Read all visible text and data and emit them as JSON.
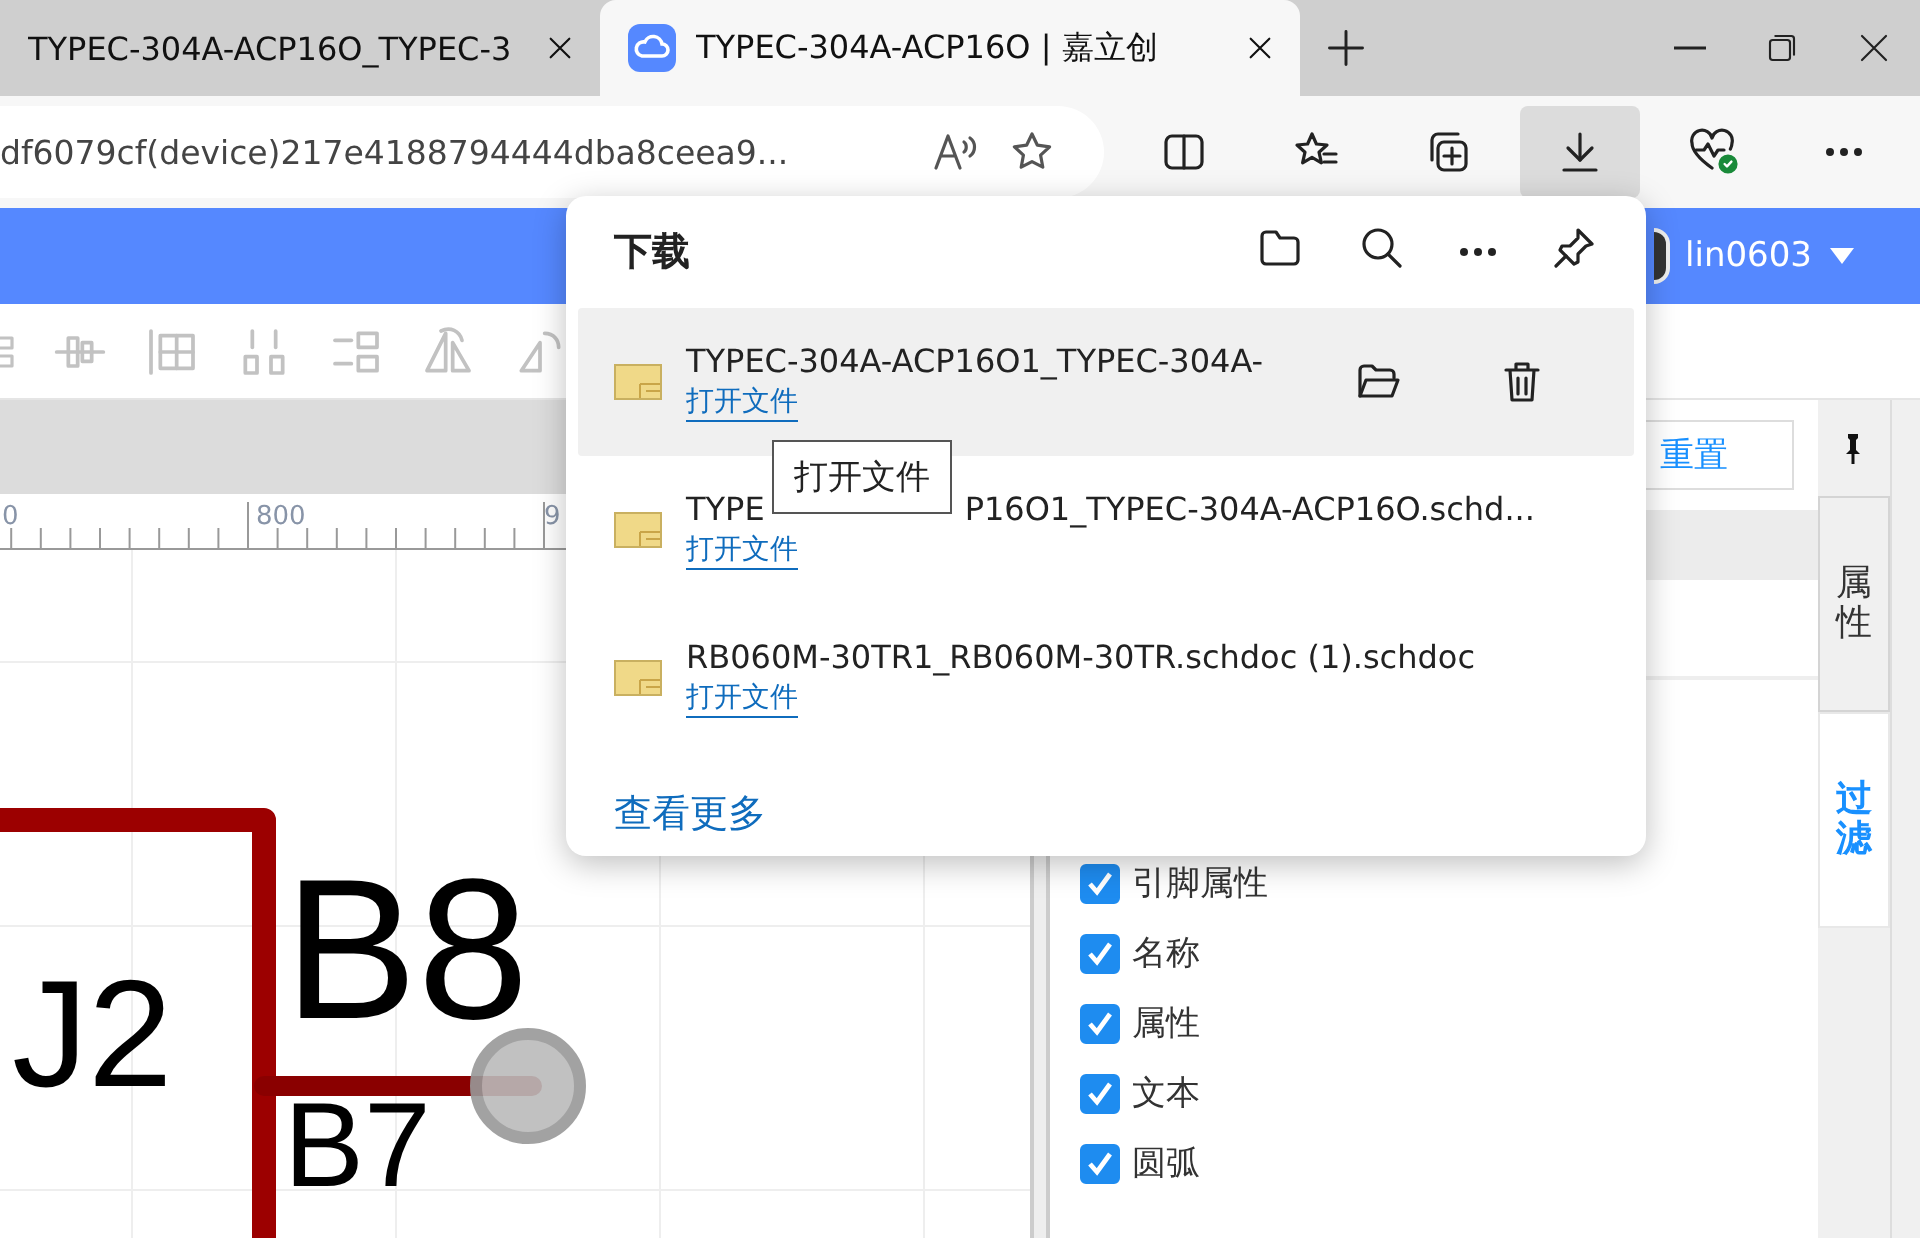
{
  "browser_tabs": [
    {
      "title": "TYPEC-304A-ACP16O_TYPEC-3",
      "selected": false
    },
    {
      "title": "TYPEC-304A-ACP16O | 嘉立创",
      "selected": true
    }
  ],
  "address_bar": {
    "url": "df6079cf(device)217e4188794444dba8ceea9..."
  },
  "browser_toolbar": [
    {
      "kind": "split",
      "selected": false
    },
    {
      "kind": "favorites",
      "selected": false
    },
    {
      "kind": "collections",
      "selected": false
    },
    {
      "kind": "downloads",
      "selected": true
    },
    {
      "kind": "health",
      "selected": false
    },
    {
      "kind": "more",
      "selected": false
    }
  ],
  "app_bar": {
    "user": "lin0603"
  },
  "ruler": {
    "labels": [
      "0",
      "800",
      "9"
    ]
  },
  "schematic": {
    "designator": "J2",
    "pins": [
      "B8",
      "B7"
    ]
  },
  "properties_panel": {
    "reset_button": "重置",
    "filters": [
      {
        "label": "引脚属性",
        "checked": true
      },
      {
        "label": "名称",
        "checked": true
      },
      {
        "label": "属性",
        "checked": true
      },
      {
        "label": "文本",
        "checked": true
      },
      {
        "label": "圆弧",
        "checked": true
      }
    ]
  },
  "side_tabs": [
    {
      "label": "属性",
      "selected": false
    },
    {
      "label": "过滤",
      "selected": true
    }
  ],
  "downloads": {
    "title": "下载",
    "items": [
      {
        "name_parts": [
          "TYPEC-304A-ACP16O1_TYPEC-304A-"
        ],
        "action": "打开文件",
        "hovered": true
      },
      {
        "name_parts": [
          "TYPE",
          "P16O1_TYPEC-304A-ACP16O.schd..."
        ],
        "action": "打开文件",
        "hovered": false
      },
      {
        "name_parts": [
          "RB060M-30TR1_RB060M-30TR.schdoc (1).schdoc"
        ],
        "action": "打开文件",
        "hovered": false
      }
    ],
    "see_more": "查看更多",
    "tooltip": "打开文件"
  }
}
